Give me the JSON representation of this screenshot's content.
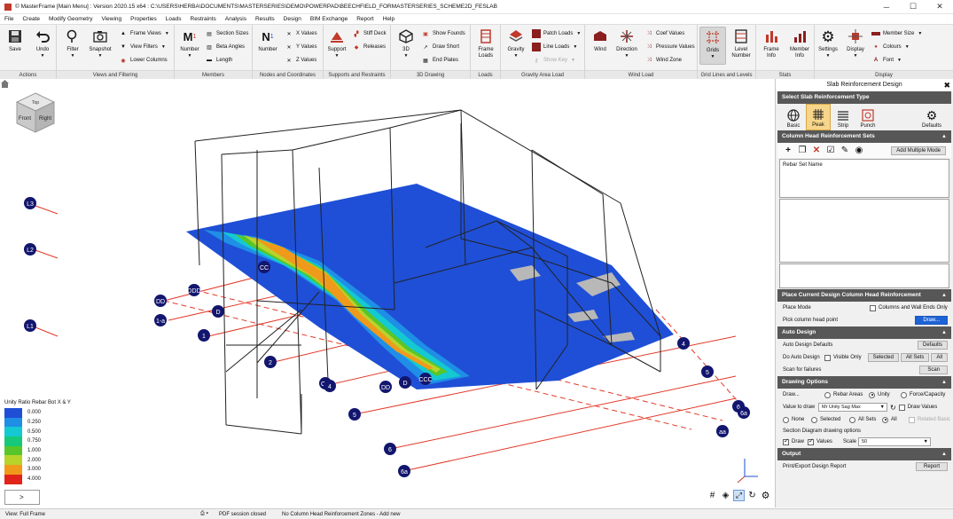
{
  "window": {
    "title": "© MasterFrame [Main Menu] : Version 2020.15 x64 : C:\\USERS\\HERBA\\DOCUMENTS\\MASTERSERIES\\DEMO\\POWERPAD\\BEECHFIELD_FORMASTERSERIES_SCHEME2D_FESLAB",
    "minimize": "─",
    "maximize": "☐",
    "close": "✕"
  },
  "menu": [
    "File",
    "Create",
    "Modify Geometry",
    "Viewing",
    "Properties",
    "Loads",
    "Restraints",
    "Analysis",
    "Results",
    "Design",
    "BIM Exchange",
    "Report",
    "Help"
  ],
  "ribbon": {
    "groups": {
      "actions": "Actions",
      "views": "Views and Filtering",
      "members": "Members",
      "nodes": "Nodes and Coordinates",
      "supports": "Supports and Restraints",
      "drawing3d": "3D Drawing",
      "loads": "Loads",
      "gravity": "Gravity Area Load",
      "wind": "Wind Load",
      "grids": "Grid Lines and Levels",
      "stats": "Stats",
      "display": "Display"
    },
    "buttons": {
      "save": "Save",
      "undo": "Undo",
      "filter": "Filter",
      "snapshot": "Snapshot",
      "frame_views": "Frame Views",
      "view_filters": "View Filters",
      "lower_columns": "Lower Columns",
      "number_m": "Number",
      "section_sizes": "Section Sizes",
      "beta_angles": "Beta Angles",
      "length": "Length",
      "number_n": "Number",
      "x_values": "X Values",
      "y_values": "Y Values",
      "z_values": "Z Values",
      "support": "Support",
      "stiff_deck": "Stiff Deck",
      "releases": "Releases",
      "3d": "3D",
      "show_founds": "Show Founds",
      "draw_short": "Draw Short",
      "end_plates": "End Plates",
      "frame_loads": "Frame\nLoads",
      "gravity": "Gravity",
      "patch_loads": "Patch Loads",
      "line_loads": "Line Loads",
      "show_key": "Show Key",
      "wind": "Wind",
      "direction": "Direction",
      "coef_values": "Coef Values",
      "pressure_values": "Pressure Values",
      "wind_zone": "Wind Zone",
      "grids": "Grids",
      "level_number": "Level\nNumber",
      "frame_info": "Frame\nInfo",
      "member_info": "Member\nInfo",
      "settings": "Settings",
      "display": "Display",
      "member_size": "Member Size",
      "colours": "Colours",
      "font": "Font"
    }
  },
  "viewport": {
    "viewcube_top": "Top",
    "viewcube_front": "Front",
    "viewcube_right": "Right",
    "legend_title": "Unity Ratio Rebar Bot X & Y",
    "legend": [
      {
        "value": "0.000",
        "color": "#1f4fd6"
      },
      {
        "value": "0.250",
        "color": "#1f8fe6"
      },
      {
        "value": "0.500",
        "color": "#14c9d2"
      },
      {
        "value": "0.750",
        "color": "#16c97a"
      },
      {
        "value": "1.000",
        "color": "#58c62a"
      },
      {
        "value": "2.000",
        "color": "#b8d32a"
      },
      {
        "value": "3.000",
        "color": "#f09a1c"
      },
      {
        "value": "4.000",
        "color": "#e0241a"
      }
    ],
    "cmd_prompt": ">",
    "grid_labels": [
      "L3",
      "L2",
      "L1",
      "DD",
      "DDD",
      "D",
      "1-a",
      "1",
      "CC",
      "2",
      "CC",
      "4",
      "DD",
      "D",
      "CCC",
      "5",
      "6",
      "6a",
      "4",
      "5",
      "6",
      "6a",
      "aa"
    ]
  },
  "panel": {
    "title": "Slab Reinforcement Design",
    "close": "✖",
    "sec_type": "Select Slab Reinforcement Type",
    "types": [
      "Basic",
      "Peak",
      "Strip",
      "Punch"
    ],
    "defaults": "Defaults",
    "sec_sets": "Column Head Reinforcement Sets",
    "add_multiple": "Add Multiple Mode",
    "list_header": "Rebar Set Name",
    "sec_place": "Place Current Design Column Head Reinforcement",
    "place_mode": "Place Mode",
    "columns_wall": "Columns and Wall Ends Only",
    "pick_point": "Pick column head point",
    "draw_btn": "Draw...",
    "sec_auto": "Auto Design",
    "auto_defaults": "Auto Design Defaults",
    "defaults_btn": "Defaults",
    "do_auto": "Do Auto Design",
    "visible_only": "Visible Only",
    "selected_btn": "Selected",
    "all_sets_btn": "All Sets",
    "all_btn": "All",
    "scan_failures": "Scan for failures",
    "scan_btn": "Scan",
    "sec_drawing": "Drawing Options",
    "draw_label": "Draw...",
    "rebar_areas": "Rebar Areas",
    "unity": "Unity",
    "force_capacity": "Force/Capacity",
    "value_to_draw": "Value to draw",
    "value_select": "Mr Unity Sag Max",
    "draw_values": "Draw Values",
    "none": "None",
    "selected": "Selected",
    "all_sets": "All Sets",
    "all": "All",
    "related_basic": "Related Basic",
    "section_diag": "Section Diagram drawing options",
    "draw_cb": "Draw",
    "values_cb": "Values",
    "scale_label": "Scale",
    "scale_value": "50",
    "sec_output": "Output",
    "print_export": "Print/Export Design Report",
    "report_btn": "Report"
  },
  "status": {
    "view": "View: Full Frame",
    "pdf": "PDF session closed",
    "message": "No Column Head Reinforcement Zones - Add new"
  }
}
